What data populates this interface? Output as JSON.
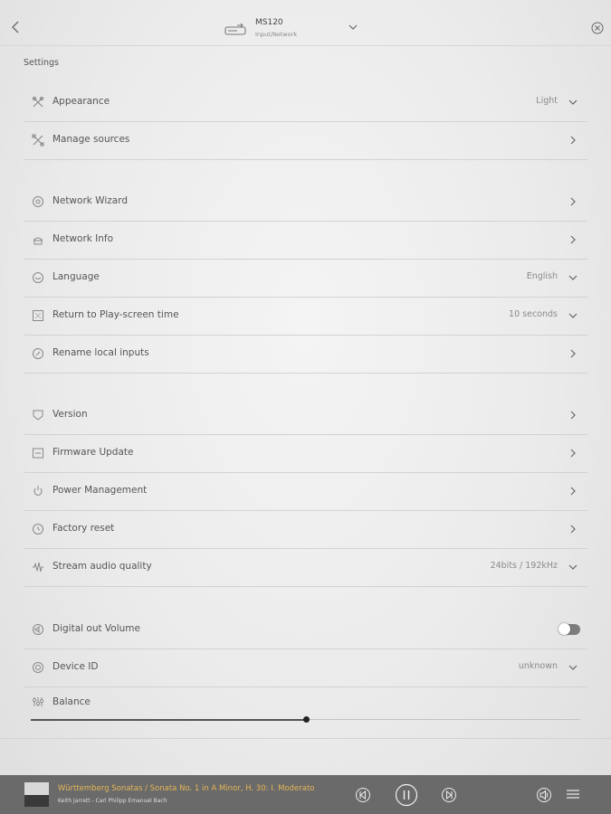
{
  "header": {
    "back_icon": "chevron-left-icon",
    "device_name": "MS120",
    "device_subtitle": "Input/Network",
    "device_icon": "device-icon",
    "dropdown_icon": "chevron-down-icon",
    "close_icon": "close-circle-icon"
  },
  "settings": {
    "title": "Settings",
    "rows": [
      {
        "label": "Appearance",
        "value": "Light",
        "icon": "tools-icon",
        "control": "dropdown"
      },
      {
        "label": "Manage sources",
        "value": "",
        "icon": "sources-icon",
        "control": "chevron"
      },
      {
        "label": "Network Wizard",
        "value": "",
        "icon": "network-wizard-icon",
        "control": "chevron"
      },
      {
        "label": "Network Info",
        "value": "",
        "icon": "network-info-icon",
        "control": "chevron"
      },
      {
        "label": "Language",
        "value": "English",
        "icon": "language-icon",
        "control": "dropdown"
      },
      {
        "label": "Return to Play-screen time",
        "value": "10 seconds",
        "icon": "timer-icon",
        "control": "dropdown"
      },
      {
        "label": "Rename local inputs",
        "value": "",
        "icon": "rename-icon",
        "control": "chevron"
      },
      {
        "label": "Version",
        "value": "",
        "icon": "version-icon",
        "control": "chevron"
      },
      {
        "label": "Firmware Update",
        "value": "",
        "icon": "firmware-icon",
        "control": "chevron"
      },
      {
        "label": "Power Management",
        "value": "",
        "icon": "power-icon",
        "control": "chevron"
      },
      {
        "label": "Factory reset",
        "value": "",
        "icon": "reset-icon",
        "control": "chevron"
      },
      {
        "label": "Stream audio quality",
        "value": "24bits / 192kHz",
        "icon": "audio-quality-icon",
        "control": "dropdown"
      },
      {
        "label": "Digital out Volume",
        "value": "",
        "icon": "volume-icon",
        "control": "toggle",
        "enabled": false
      },
      {
        "label": "Device ID",
        "value": "unknown",
        "icon": "device-id-icon",
        "control": "dropdown"
      }
    ],
    "balance": {
      "label": "Balance",
      "icon": "balance-icon",
      "level": 0.5
    }
  },
  "player": {
    "track_title": "Württemberg Sonatas / Sonata No. 1 in A Minor, H. 30: I. Moderato",
    "track_artist": "Keith Jarrett - Carl Philipp Emanuel Bach",
    "accent_color": "#e5b657",
    "controls": [
      "previous-icon",
      "pause-icon",
      "next-icon",
      "speaker-icon",
      "queue-icon"
    ]
  }
}
